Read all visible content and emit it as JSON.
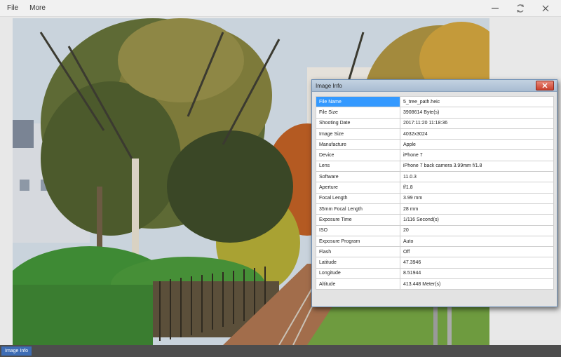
{
  "menu": {
    "file": "File",
    "more": "More"
  },
  "window_controls": [
    "minimize-icon",
    "restore-icon",
    "close-icon"
  ],
  "status_bar": {
    "tab_label": "Image Info"
  },
  "dialog": {
    "title": "Image Info",
    "rows": [
      {
        "key": "File Name",
        "value": "5_tree_path.heic",
        "selected": true
      },
      {
        "key": "File Size",
        "value": "3908614 Byte(s)"
      },
      {
        "key": "Shooting Date",
        "value": "2017:11:20 11:18:36"
      },
      {
        "key": "Image Size",
        "value": "4032x3024"
      },
      {
        "key": "Manufacture",
        "value": "Apple"
      },
      {
        "key": "Device",
        "value": "iPhone 7"
      },
      {
        "key": "Lens",
        "value": "iPhone 7 back camera 3.99mm f/1.8"
      },
      {
        "key": "Software",
        "value": "11.0.3"
      },
      {
        "key": "Aperture",
        "value": "f/1.8"
      },
      {
        "key": "Focal Length",
        "value": "3.99 mm"
      },
      {
        "key": "35mm Focal Length",
        "value": "28 mm"
      },
      {
        "key": "Exposure Time",
        "value": "1/116 Second(s)"
      },
      {
        "key": "ISO",
        "value": "20"
      },
      {
        "key": "Exposure Program",
        "value": "Auto"
      },
      {
        "key": "Flash",
        "value": "Off"
      },
      {
        "key": "Latitude",
        "value": "47.3946"
      },
      {
        "key": "Longitude",
        "value": "8.51944"
      },
      {
        "key": "Altitude",
        "value": "413.448 Meter(s)"
      }
    ]
  },
  "colors": {
    "selection": "#3399ff",
    "status_bar": "#4d4d4d",
    "status_tab": "#3e6db5",
    "close_button": "#c9402d"
  }
}
